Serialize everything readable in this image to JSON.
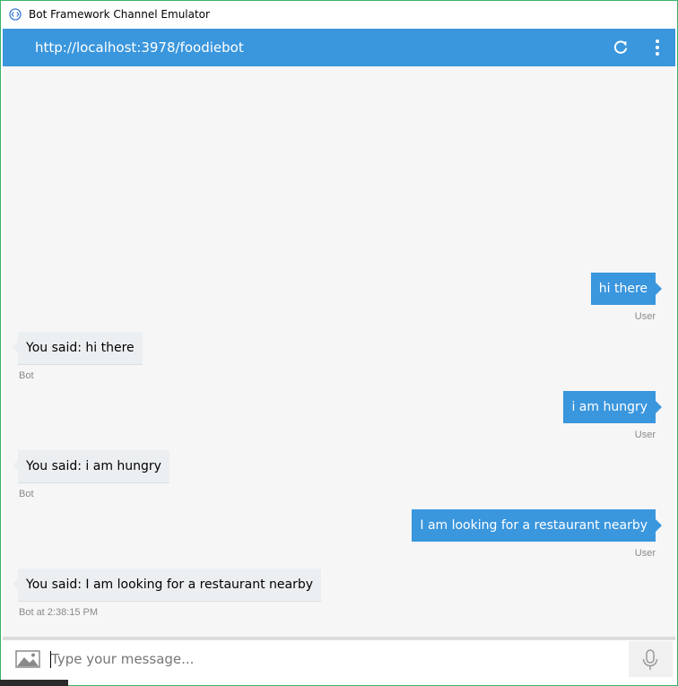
{
  "window": {
    "title": "Bot Framework Channel Emulator"
  },
  "appbar": {
    "address": "http://localhost:3978/foodiebot",
    "refresh_icon": "refresh-icon",
    "menu_icon": "more-vert-icon"
  },
  "colors": {
    "accent": "#3a96dd",
    "bot_bubble": "#eceff1",
    "chat_background": "#f6f6f6"
  },
  "messages": [
    {
      "from": "user",
      "text": "hi there",
      "meta": "User"
    },
    {
      "from": "bot",
      "text": "You said: hi there",
      "meta": "Bot"
    },
    {
      "from": "user",
      "text": "i am hungry",
      "meta": "User"
    },
    {
      "from": "bot",
      "text": "You said: i am hungry",
      "meta": "Bot"
    },
    {
      "from": "user",
      "text": "I am looking for a restaurant nearby",
      "meta": "User"
    },
    {
      "from": "bot",
      "text": "You said: I am looking for a restaurant nearby",
      "meta": "Bot at 2:38:15 PM"
    }
  ],
  "composer": {
    "placeholder": "Type your message...",
    "value": "",
    "upload_icon": "image-upload-icon",
    "mic_icon": "microphone-icon"
  }
}
